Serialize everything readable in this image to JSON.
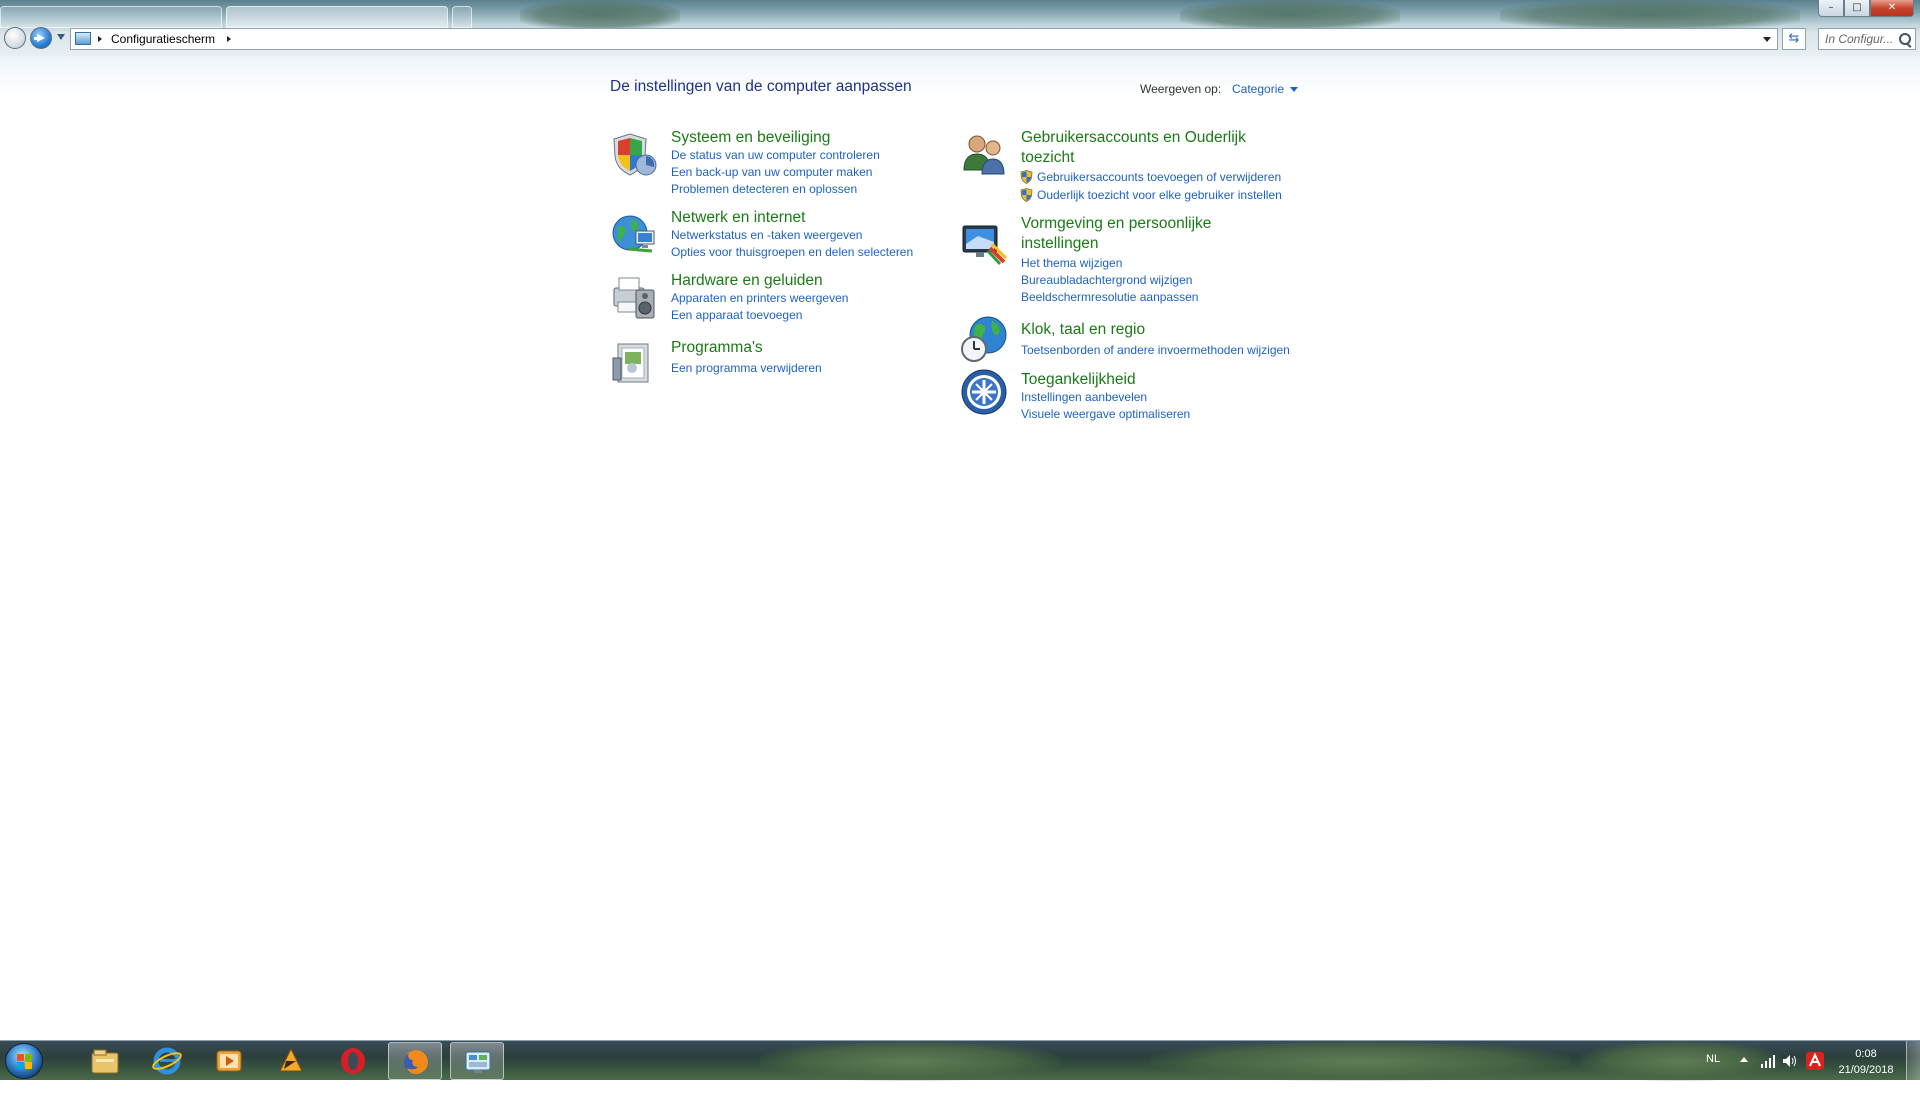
{
  "window": {
    "address": {
      "crumbs": [
        "Configuratiescherm"
      ]
    },
    "search": {
      "placeholder": "In Configur..."
    },
    "controls": {
      "minimize": "–",
      "maximize": "□",
      "close": "✕"
    }
  },
  "header": {
    "title": "De instellingen van de computer aanpassen",
    "view_by_label": "Weergeven op:",
    "view_by_value": "Categorie"
  },
  "categories_left": [
    {
      "title": "Systeem en beveiliging",
      "icon": "shield-icon",
      "links": [
        "De status van uw computer controleren",
        "Een back-up van uw computer maken",
        "Problemen detecteren en oplossen"
      ]
    },
    {
      "title": "Netwerk en internet",
      "icon": "network-globe-icon",
      "links": [
        "Netwerkstatus en -taken weergeven",
        "Opties voor thuisgroepen en delen selecteren"
      ]
    },
    {
      "title": "Hardware en geluiden",
      "icon": "printer-speaker-icon",
      "links": [
        "Apparaten en printers weergeven",
        "Een apparaat toevoegen"
      ]
    },
    {
      "title": "Programma's",
      "icon": "programs-icon",
      "links": [
        "Een programma verwijderen"
      ]
    }
  ],
  "categories_right": [
    {
      "title_line1": "Gebruikersaccounts en Ouderlijk",
      "title_line2": "toezicht",
      "icon": "users-icon",
      "links": [
        "Gebruikersaccounts toevoegen of verwijderen",
        "Ouderlijk toezicht voor elke gebruiker instellen"
      ]
    },
    {
      "title_line1": "Vormgeving en persoonlijke",
      "title_line2": "instellingen",
      "icon": "monitor-appearance-icon",
      "links": [
        "Het thema wijzigen",
        "Bureaubladachtergrond wijzigen",
        "Beeldschermresolutie aanpassen"
      ]
    },
    {
      "title": "Klok, taal en regio",
      "icon": "clock-globe-icon",
      "links": [
        "Toetsenborden of andere invoermethoden wijzigen"
      ]
    },
    {
      "title": "Toegankelijkheid",
      "icon": "accessibility-icon",
      "links": [
        "Instellingen aanbevelen",
        "Visuele weergave optimaliseren"
      ]
    }
  ],
  "taskbar": {
    "apps": [
      "explorer-icon",
      "internet-explorer-icon",
      "media-player-icon",
      "winamp-icon",
      "opera-icon",
      "firefox-icon",
      "control-panel-icon"
    ],
    "language": "NL",
    "time": "0:08",
    "date": "21/09/2018"
  },
  "colors": {
    "title_blue": "#1e3287",
    "link_blue": "#1e62c0",
    "category_green": "#1a7a16"
  }
}
